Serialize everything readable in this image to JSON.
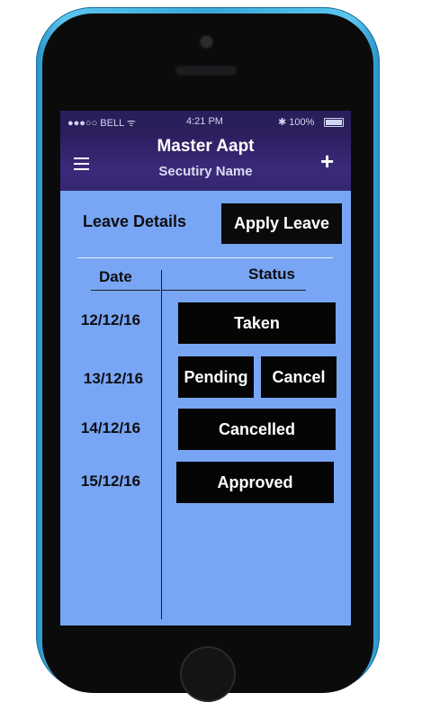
{
  "status_bar": {
    "carrier": "●●●○○ BELL ᯤ",
    "time": "4:21 PM",
    "battery": "✱ 100%",
    "battery_level": 1.0
  },
  "nav": {
    "title": "Master Aapt",
    "subtitle": "Secutiry Name",
    "menu_icon": "hamburger-icon",
    "add_icon": "plus-icon",
    "add_glyph": "+"
  },
  "leave": {
    "section_title": "Leave Details",
    "apply_label": "Apply Leave",
    "col_date": "Date",
    "col_status": "Status",
    "rows": [
      {
        "date": "12/12/16",
        "status": "Taken"
      },
      {
        "date": "13/12/16",
        "status": "Pending",
        "action": "Cancel"
      },
      {
        "date": "14/12/16",
        "status": "Cancelled"
      },
      {
        "date": "15/12/16",
        "status": "Approved"
      }
    ]
  },
  "colors": {
    "screen_bg": "#78a6f4",
    "nav_bg": "#2c1d5e",
    "button_bg": "#050505",
    "phone_frame": "#3aa7d8"
  }
}
